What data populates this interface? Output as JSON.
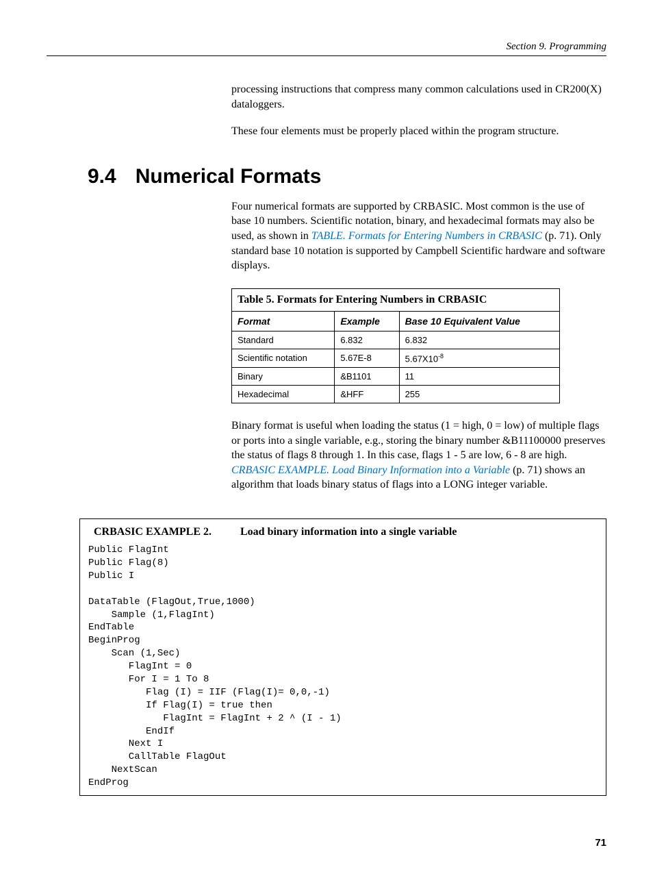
{
  "header": {
    "section_label": "Section 9.  Programming"
  },
  "intro": {
    "p1": "processing instructions that compress many common calculations used in CR200(X) dataloggers.",
    "p2": "These four elements must be properly placed within the program structure."
  },
  "heading": {
    "number": "9.4",
    "title": "Numerical Formats"
  },
  "body1": {
    "text_before_link": "Four numerical formats are supported by CRBASIC. Most common is the use of base 10 numbers. Scientific notation, binary, and hexadecimal formats may also be used, as shown in ",
    "link_text": "TABLE. Formats for Entering Numbers in CRBASIC",
    "text_after_link": " (p. 71). Only standard base 10 notation is supported by Campbell Scientific hardware and software displays."
  },
  "table": {
    "caption": "Table 5. Formats for Entering Numbers in CRBASIC",
    "headers": [
      "Format",
      "Example",
      "Base 10 Equivalent Value"
    ],
    "rows": [
      {
        "format": "Standard",
        "example": "6.832",
        "value": "6.832"
      },
      {
        "format": "Scientific notation",
        "example": "5.67E-8",
        "value_prefix": "5.67X10",
        "value_exp": "-8"
      },
      {
        "format": "Binary",
        "example": "&B1101",
        "value": "11"
      },
      {
        "format": "Hexadecimal",
        "example": "&HFF",
        "value": "255"
      }
    ]
  },
  "body2": {
    "text_before_link": "Binary format is useful when loading the status (1 = high, 0 = low) of multiple flags or ports into a single variable, e.g., storing the binary number &B11100000 preserves the status of flags 8 through 1. In this case, flags 1 - 5 are low, 6 - 8 are high. ",
    "link_text": "CRBASIC EXAMPLE. Load Binary Information into a Variable",
    "text_after_link": " (p. 71) shows an algorithm that loads binary status of flags into a LONG integer variable."
  },
  "example": {
    "label": "CRBASIC EXAMPLE 2.",
    "title": "Load binary information into a single variable",
    "code": "Public FlagInt\nPublic Flag(8)\nPublic I\n\nDataTable (FlagOut,True,1000)\n    Sample (1,FlagInt)\nEndTable\nBeginProg\n    Scan (1,Sec)\n       FlagInt = 0\n       For I = 1 To 8\n          Flag (I) = IIF (Flag(I)= 0,0,-1)\n          If Flag(I) = true then\n             FlagInt = FlagInt + 2 ^ (I - 1)\n          EndIf\n       Next I\n       CallTable FlagOut\n    NextScan\nEndProg"
  },
  "page_number": "71"
}
